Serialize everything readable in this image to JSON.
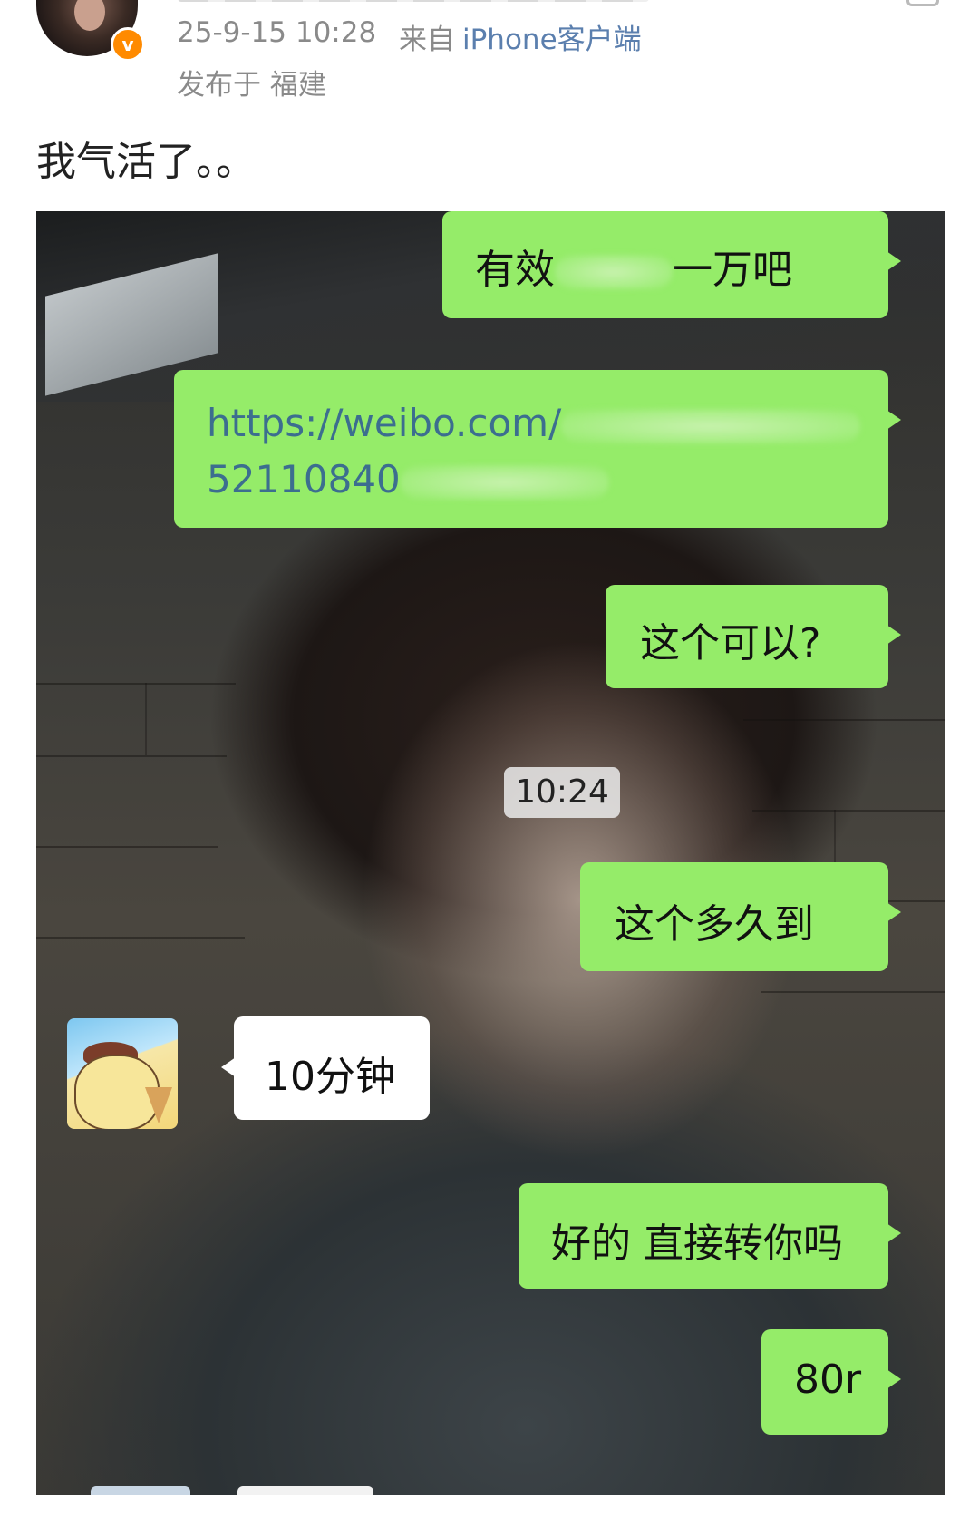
{
  "post": {
    "timestamp": "25-9-15 10:28",
    "source_prefix": "来自",
    "source": "iPhone客户端",
    "location": "发布于 福建",
    "text": "我气活了。。"
  },
  "chat": {
    "bubble_colors": {
      "outgoing": "#95ec69",
      "incoming": "#ffffff"
    },
    "messages": [
      {
        "side": "right",
        "text_visible_start": "有效",
        "text_visible_end": "一万吧"
      },
      {
        "side": "right",
        "link_line1": "https://weibo.com/",
        "link_line2": "52110840"
      },
      {
        "side": "right",
        "text": "这个可以?"
      },
      {
        "type": "timestamp",
        "text": "10:24"
      },
      {
        "side": "right",
        "text": "这个多久到"
      },
      {
        "side": "left",
        "text": "10分钟"
      },
      {
        "side": "right",
        "text": "好的 直接转你吗"
      },
      {
        "side": "right",
        "text": "80r"
      }
    ]
  }
}
